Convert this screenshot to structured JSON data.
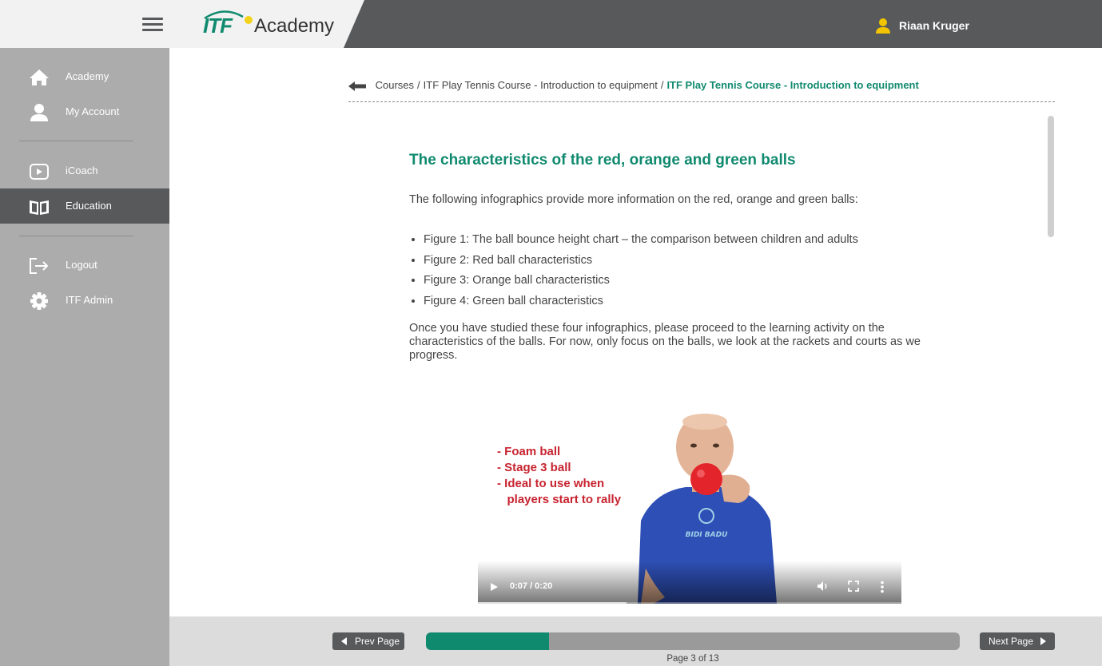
{
  "header": {
    "logo_itf": "ITF",
    "logo_academy": "Academy",
    "user_name": "Riaan Kruger"
  },
  "sidebar": {
    "items": [
      {
        "label": "Academy",
        "icon": "home-icon"
      },
      {
        "label": "My Account",
        "icon": "user-icon"
      },
      {
        "label": "iCoach",
        "icon": "play-icon"
      },
      {
        "label": "Education",
        "icon": "book-icon",
        "active": true
      },
      {
        "label": "Logout",
        "icon": "logout-icon"
      },
      {
        "label": "ITF Admin",
        "icon": "gear-icon"
      }
    ]
  },
  "breadcrumb": {
    "items": [
      "Courses",
      "ITF Play Tennis Course - Introduction to equipment"
    ],
    "current": "ITF Play Tennis Course - Introduction to equipment"
  },
  "content": {
    "title": "The characteristics of the red, orange and green balls",
    "intro": "The following infographics provide more information on the red, orange and green balls:",
    "figures": [
      "Figure 1: The ball bounce height chart – the comparison between children and adults",
      "Figure 2: Red ball characteristics",
      "Figure 3: Orange ball characteristics",
      "Figure 4: Green ball characteristics"
    ],
    "outro": "Once you have studied these four infographics, please proceed to the learning activity on the characteristics of the balls. For now, only focus on the balls, we look at the rackets and courts as we progress."
  },
  "video": {
    "overlay_lines": [
      "- Foam ball",
      "- Stage 3 ball",
      "- Ideal to use when",
      "   players start to rally"
    ],
    "time": "0:07 / 0:20",
    "progress_fraction": 0.35
  },
  "footer": {
    "prev_label": "Prev Page",
    "next_label": "Next Page",
    "page_label": "Page 3 of 13",
    "progress_fraction": 0.23
  },
  "colors": {
    "brand_green": "#108a6f",
    "header_dark": "#58595b",
    "sidebar_grey": "#acacac",
    "video_text_red": "#c7232f",
    "logo_yellow": "#f2d21a"
  }
}
